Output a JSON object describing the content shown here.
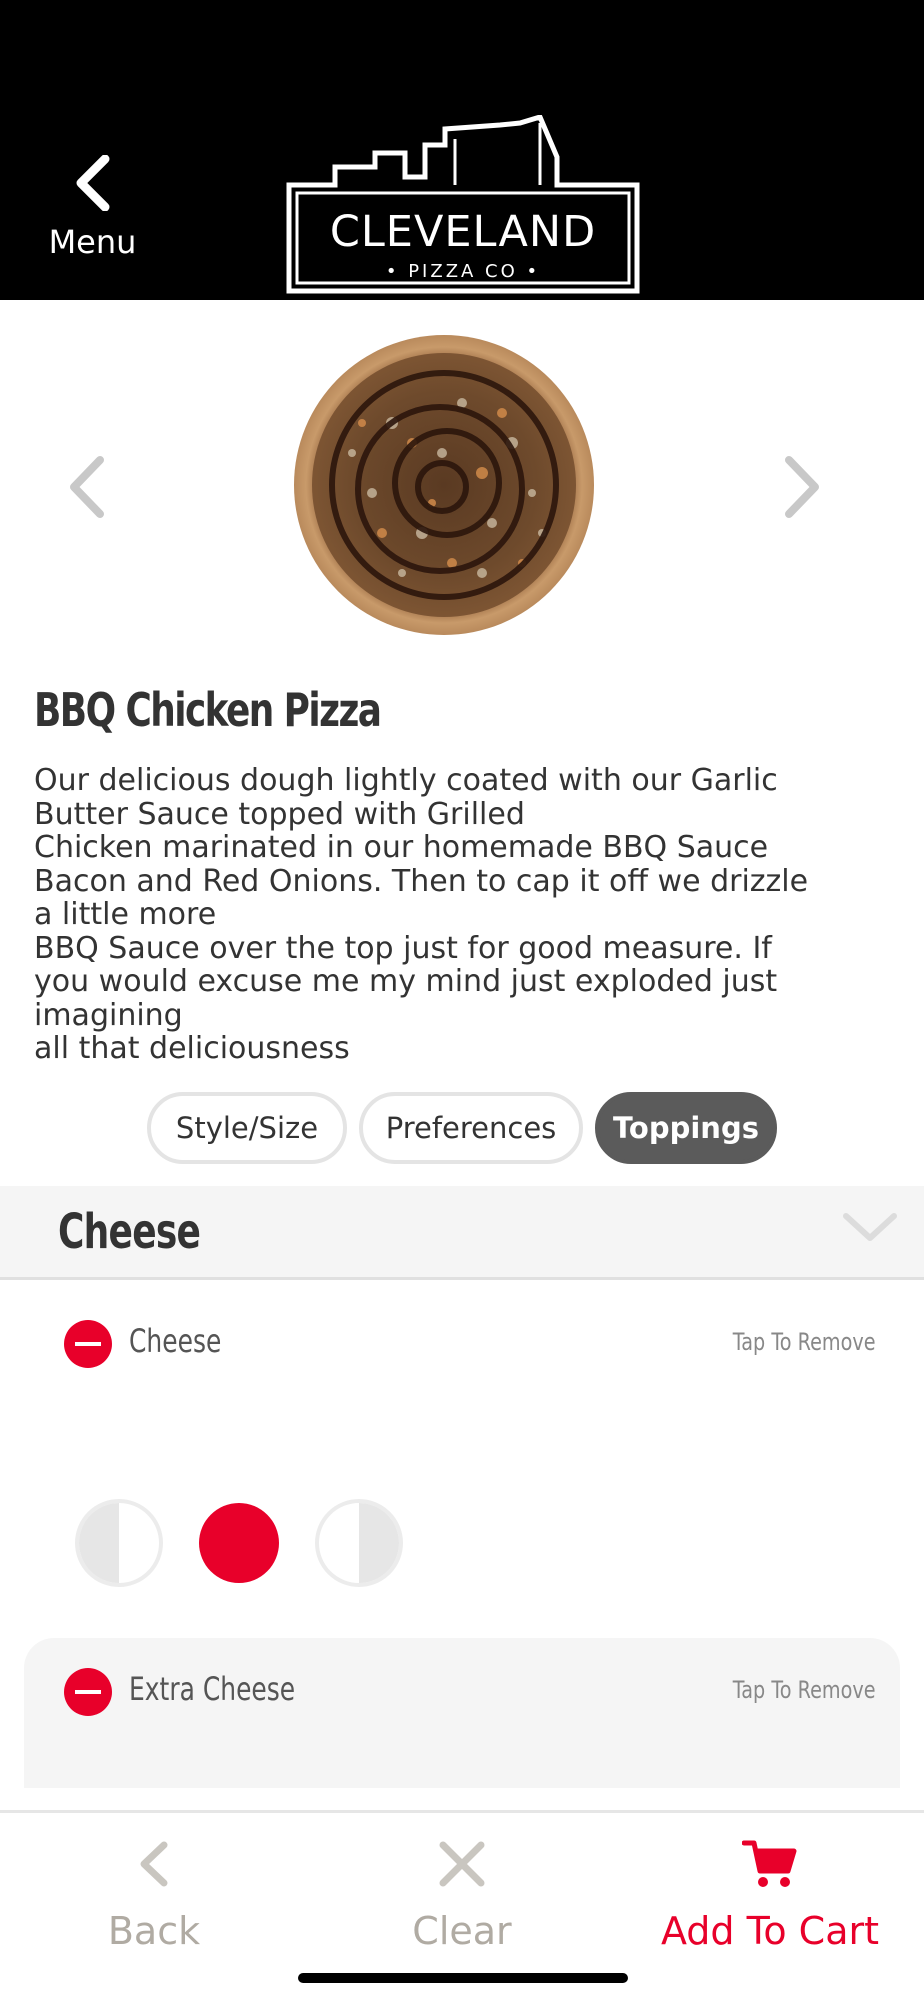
{
  "header": {
    "back_label": "Menu",
    "logo_main": "CLEVELAND",
    "logo_sub": "• PIZZA CO •"
  },
  "product": {
    "title": "BBQ Chicken Pizza",
    "description": "Our delicious dough lightly coated with our Garlic\nButter Sauce topped with Grilled\nChicken marinated in our homemade BBQ Sauce\nBacon and Red Onions. Then to cap it off we drizzle\na little more\nBBQ Sauce over the top just for good measure. If\nyou would excuse me my mind just exploded just\nimagining\nall that deliciousness"
  },
  "tabs": [
    {
      "label": "Style/Size",
      "active": false
    },
    {
      "label": "Preferences",
      "active": false
    },
    {
      "label": "Toppings",
      "active": true
    }
  ],
  "section": {
    "name": "Cheese",
    "toppings": [
      {
        "name": "Cheese",
        "action": "Tap To Remove",
        "portion_selected": "whole"
      },
      {
        "name": "Extra Cheese",
        "action": "Tap To Remove"
      }
    ]
  },
  "bottom_nav": {
    "back": "Back",
    "clear": "Clear",
    "add_to_cart": "Add To Cart"
  },
  "colors": {
    "accent_red": "#e8002a",
    "header_bg": "#000000",
    "tab_active_bg": "#5b5b5b",
    "muted_label": "#b0aba3"
  },
  "icons": {
    "back": "chevron-left-icon",
    "prev": "chevron-left-icon",
    "next": "chevron-right-icon",
    "collapse": "chevron-down-icon",
    "remove": "minus-circle-icon",
    "clear": "x-icon",
    "cart": "cart-icon"
  }
}
